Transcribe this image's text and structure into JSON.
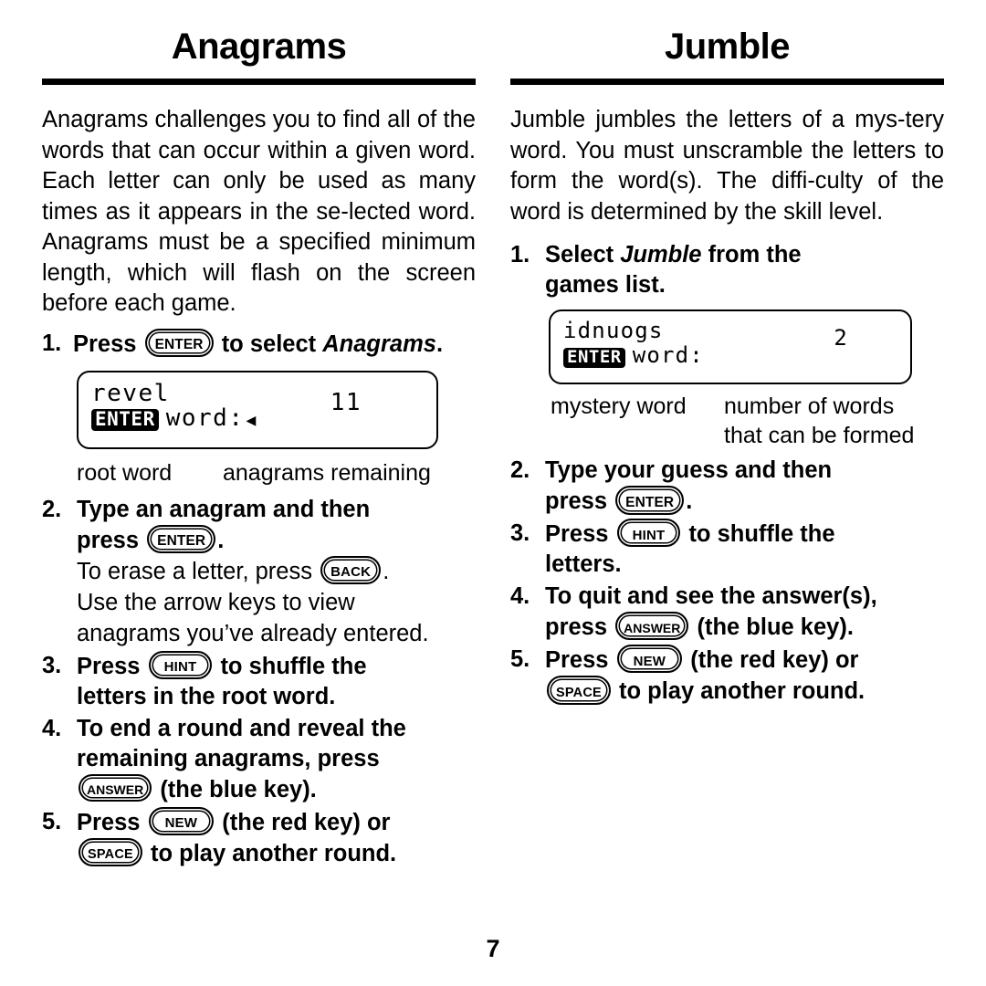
{
  "page": {
    "number": "7"
  },
  "left_column": {
    "title": "Anagrams",
    "intro": "Anagrams challenges you to find all of the words that can occur within a given word. Each letter can only be used as many times as it appears in the se-lected word. Anagrams must be a specified minimum length, which will flash on the screen before each game.",
    "steps": [
      {
        "num": "1.",
        "before_key": "Press ",
        "key": "ENTER",
        "after_key": " to select ",
        "italic": "Anagrams",
        "tail": "."
      },
      {
        "num": "2.",
        "line1": "Type an anagram and then",
        "line2_before": "press ",
        "line2_key": "ENTER",
        "line2_after": ".",
        "sub_before": "To erase a letter, press ",
        "sub_key": "BACK",
        "sub_after": ".",
        "sub_line2": "Use the arrow keys to view",
        "sub_line3": "anagrams you’ve already entered."
      },
      {
        "num": "3.",
        "before_key": "Press ",
        "key": "HINT",
        "after_key": " to shuffle the",
        "line2": "letters in the root word."
      },
      {
        "num": "4.",
        "line1": "To end a round and reveal the",
        "line2": "remaining anagrams, press",
        "key": "ANSWER",
        "after_key": " (the blue key)."
      },
      {
        "num": "5.",
        "before_key": "Press ",
        "key": "NEW",
        "after_key": " (the red key) or",
        "key2": "SPACE",
        "after_key2": " to play another round."
      }
    ],
    "lcd": {
      "word": "revel",
      "count": "11",
      "badge": "ENTER",
      "prompt": "word:",
      "cursor": "◀"
    },
    "captions": {
      "left": "root word",
      "right": "anagrams remaining"
    }
  },
  "right_column": {
    "title": "Jumble",
    "intro": "Jumble jumbles the letters of a mys-tery word. You must unscramble the letters to form the word(s). The diffi-culty of the word is determined by the skill level.",
    "steps": [
      {
        "num": "1.",
        "before_italic": "Select ",
        "italic": "Jumble",
        "after_italic": " from the",
        "line2": "games list."
      },
      {
        "num": "2.",
        "line1": "Type your guess and then",
        "line2_before": "press ",
        "line2_key": "ENTER",
        "line2_after": "."
      },
      {
        "num": "3.",
        "before_key": " Press ",
        "key": "HINT",
        "after_key": " to shuffle the",
        "line2": "letters."
      },
      {
        "num": "4.",
        "line1": "To quit and see the answer(s),",
        "line2_before": "press ",
        "key": "ANSWER",
        "after_key": " (the blue key)."
      },
      {
        "num": "5.",
        "before_key": "Press ",
        "key": "NEW",
        "after_key": " (the red key) or",
        "key2": "SPACE",
        "after_key2": " to play another round."
      }
    ],
    "lcd": {
      "word": "idnuogs",
      "count": "2",
      "badge": "ENTER",
      "prompt": "word:"
    },
    "captions": {
      "left": "mystery word",
      "right_line1": "number of words",
      "right_line2": "that can be formed"
    }
  }
}
